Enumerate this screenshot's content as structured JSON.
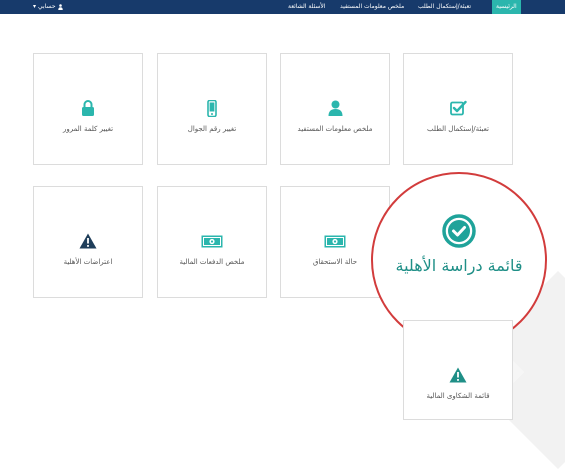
{
  "nav": {
    "items": [
      "الرئيسية",
      "تعبئة/إستكمال الطلب",
      "ملخص معلومات المستفيد",
      "الأسئلة الشائعة"
    ],
    "account": "حسابي"
  },
  "tiles": {
    "complete_request": "تعبئة/إستكمال الطلب",
    "beneficiary_summary": "ملخص معلومات المستفيد",
    "change_mobile": "تغيير رقم الجوال",
    "change_password": "تغيير كلمة المرور",
    "eligibility_status": "حالة الاستحقاق",
    "payments_summary": "ملخص الدفعات المالية",
    "eligibility_objections": "اعتراضات الأهلية",
    "financial_complaints": "قائمة الشكاوى المالية"
  },
  "highlight": {
    "label": "قائمة دراسة الأهلية"
  },
  "colors": {
    "primary": "#2bb6ad",
    "navbar": "#173a6b",
    "highlight_border": "#d23c3c"
  },
  "icons": [
    "checkbox-icon",
    "user-icon",
    "mobile-icon",
    "lock-icon",
    "check-circle-icon",
    "money-icon",
    "warning-icon",
    "user-icon"
  ]
}
